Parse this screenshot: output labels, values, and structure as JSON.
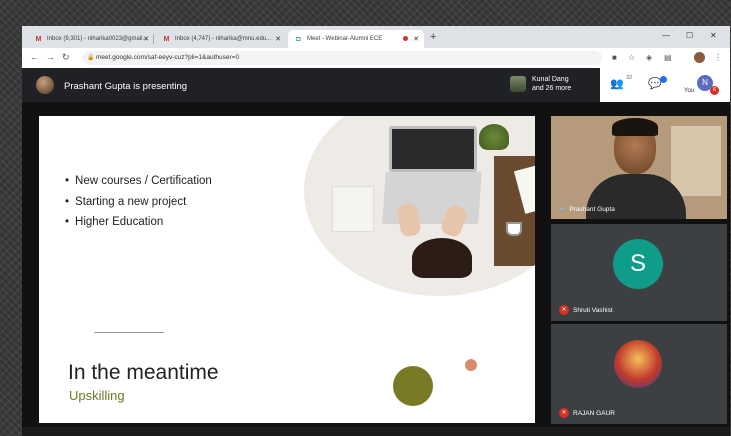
{
  "tabs": [
    {
      "icon": "gmail-icon",
      "title": "Inbox (9,301) - niharika0023@gmail..."
    },
    {
      "icon": "gmail-icon",
      "title": "Inbox (4,747) - niharika@mnu.edu..."
    },
    {
      "icon": "meet-icon",
      "title": "Meet - Webinar-Alumni ECE",
      "recording": true
    }
  ],
  "url": "meet.google.com/saf-eeyv-cuz?pli=1&authuser=0",
  "meet": {
    "presenting_text": "Prashant Gupta is presenting",
    "participant_name": "Kunal Dang",
    "participant_more": "and 26 more",
    "people_count": "32",
    "you_label": "You",
    "avatar_initial": "N",
    "notification_count": "6"
  },
  "slide": {
    "bullets": [
      "New courses / Certification",
      "Starting a new project",
      "Higher Education"
    ],
    "title": "In the meantime",
    "subtitle": "Upskilling"
  },
  "participants": [
    {
      "name": "Prashant Gupta",
      "type": "video"
    },
    {
      "name": "Shruti Vashist",
      "initial": "S",
      "muted": true
    },
    {
      "name": "RAJAN GAUR",
      "muted": true
    }
  ],
  "colors": {
    "meet_bar": "#202124",
    "tile_bg": "#3c4043",
    "shruti_avatar": "#0f9d8a",
    "mute_red": "#d93025",
    "subtitle_olive": "#6b7a1f"
  }
}
